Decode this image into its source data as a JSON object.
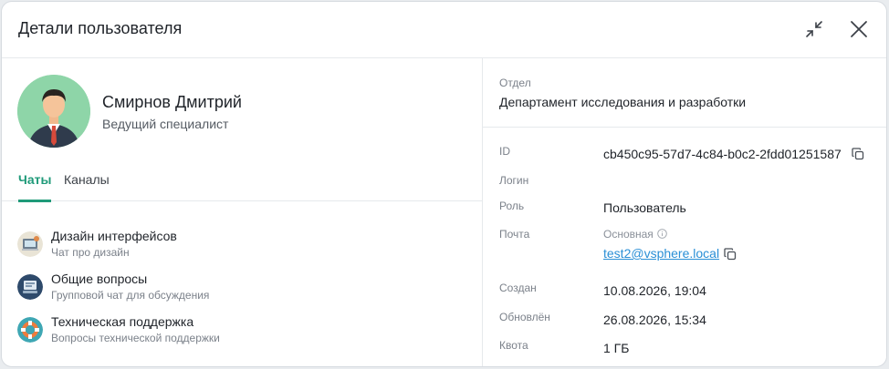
{
  "header": {
    "title": "Детали пользователя"
  },
  "user": {
    "name": "Смирнов Дмитрий",
    "position": "Ведущий специалист"
  },
  "tabs": [
    {
      "label": "Чаты",
      "active": true
    },
    {
      "label": "Каналы",
      "active": false
    }
  ],
  "chats": [
    {
      "name": "Дизайн интерфейсов",
      "description": "Чат про дизайн",
      "icon": "design-chat-icon"
    },
    {
      "name": "Общие вопросы",
      "description": "Групповой чат для обсуждения",
      "icon": "general-chat-icon"
    },
    {
      "name": "Техническая поддержка",
      "description": "Вопросы технической поддержки",
      "icon": "support-chat-icon"
    }
  ],
  "department": {
    "label": "Отдел",
    "value": "Департамент исследования и разработки"
  },
  "fields": {
    "id": {
      "label": "ID",
      "value": "cb450c95-57d7-4c84-b0c2-2fdd01251587"
    },
    "login": {
      "label": "Логин",
      "value": ""
    },
    "role": {
      "label": "Роль",
      "value": "Пользователь"
    },
    "email": {
      "label": "Почта",
      "sublabel": "Основная",
      "value": "test2@vsphere.local"
    },
    "created": {
      "label": "Создан",
      "value": "10.08.2026, 19:04"
    },
    "updated": {
      "label": "Обновлён",
      "value": "26.08.2026, 15:34"
    },
    "quota": {
      "label": "Квота",
      "value": "1 ГБ"
    }
  },
  "colors": {
    "accent": "#1f9a79",
    "link": "#2a8fd6",
    "avatar_bg": "#8ed5a8"
  }
}
